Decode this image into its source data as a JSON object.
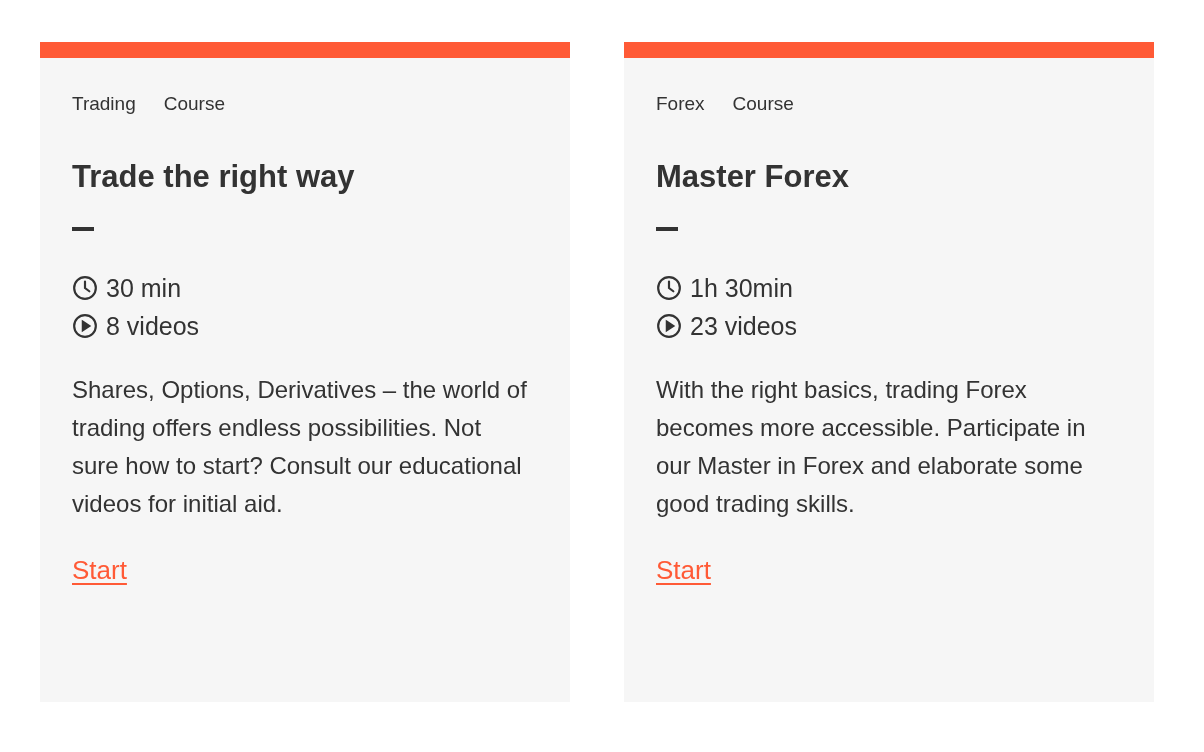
{
  "cards": [
    {
      "tags": [
        "Trading",
        "Course"
      ],
      "title": "Trade the right way",
      "duration": "30 min",
      "videos": "8 videos",
      "description": "Shares, Options, Derivatives – the world of trading offers endless possibilities. Not sure how to start? Consult our educational videos for initial aid.",
      "link": "Start"
    },
    {
      "tags": [
        "Forex",
        "Course"
      ],
      "title": "Master Forex",
      "duration": "1h 30min",
      "videos": "23 videos",
      "description": "With the right basics, trading Forex becomes more accessible. Participate in our Master in Forex and elaborate some good trading skills.",
      "link": "Start"
    }
  ]
}
